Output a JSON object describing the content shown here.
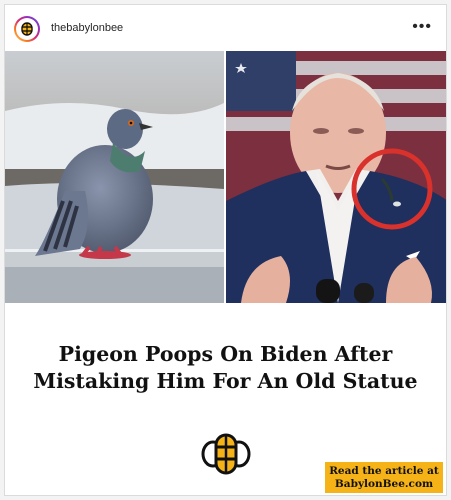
{
  "post": {
    "username": "thebabylonbee",
    "more_label": "•••",
    "headline_line1": "Pigeon Poops On Biden After",
    "headline_line2": "Mistaking Him For An Old Statue",
    "cta_line1": "Read the article at",
    "cta_line2": "BabylonBee.com"
  },
  "colors": {
    "cta_background": "#f6b318",
    "highlight_circle": "#d9312b"
  },
  "icons": [
    "more-options-icon",
    "babylon-bee-logo"
  ]
}
